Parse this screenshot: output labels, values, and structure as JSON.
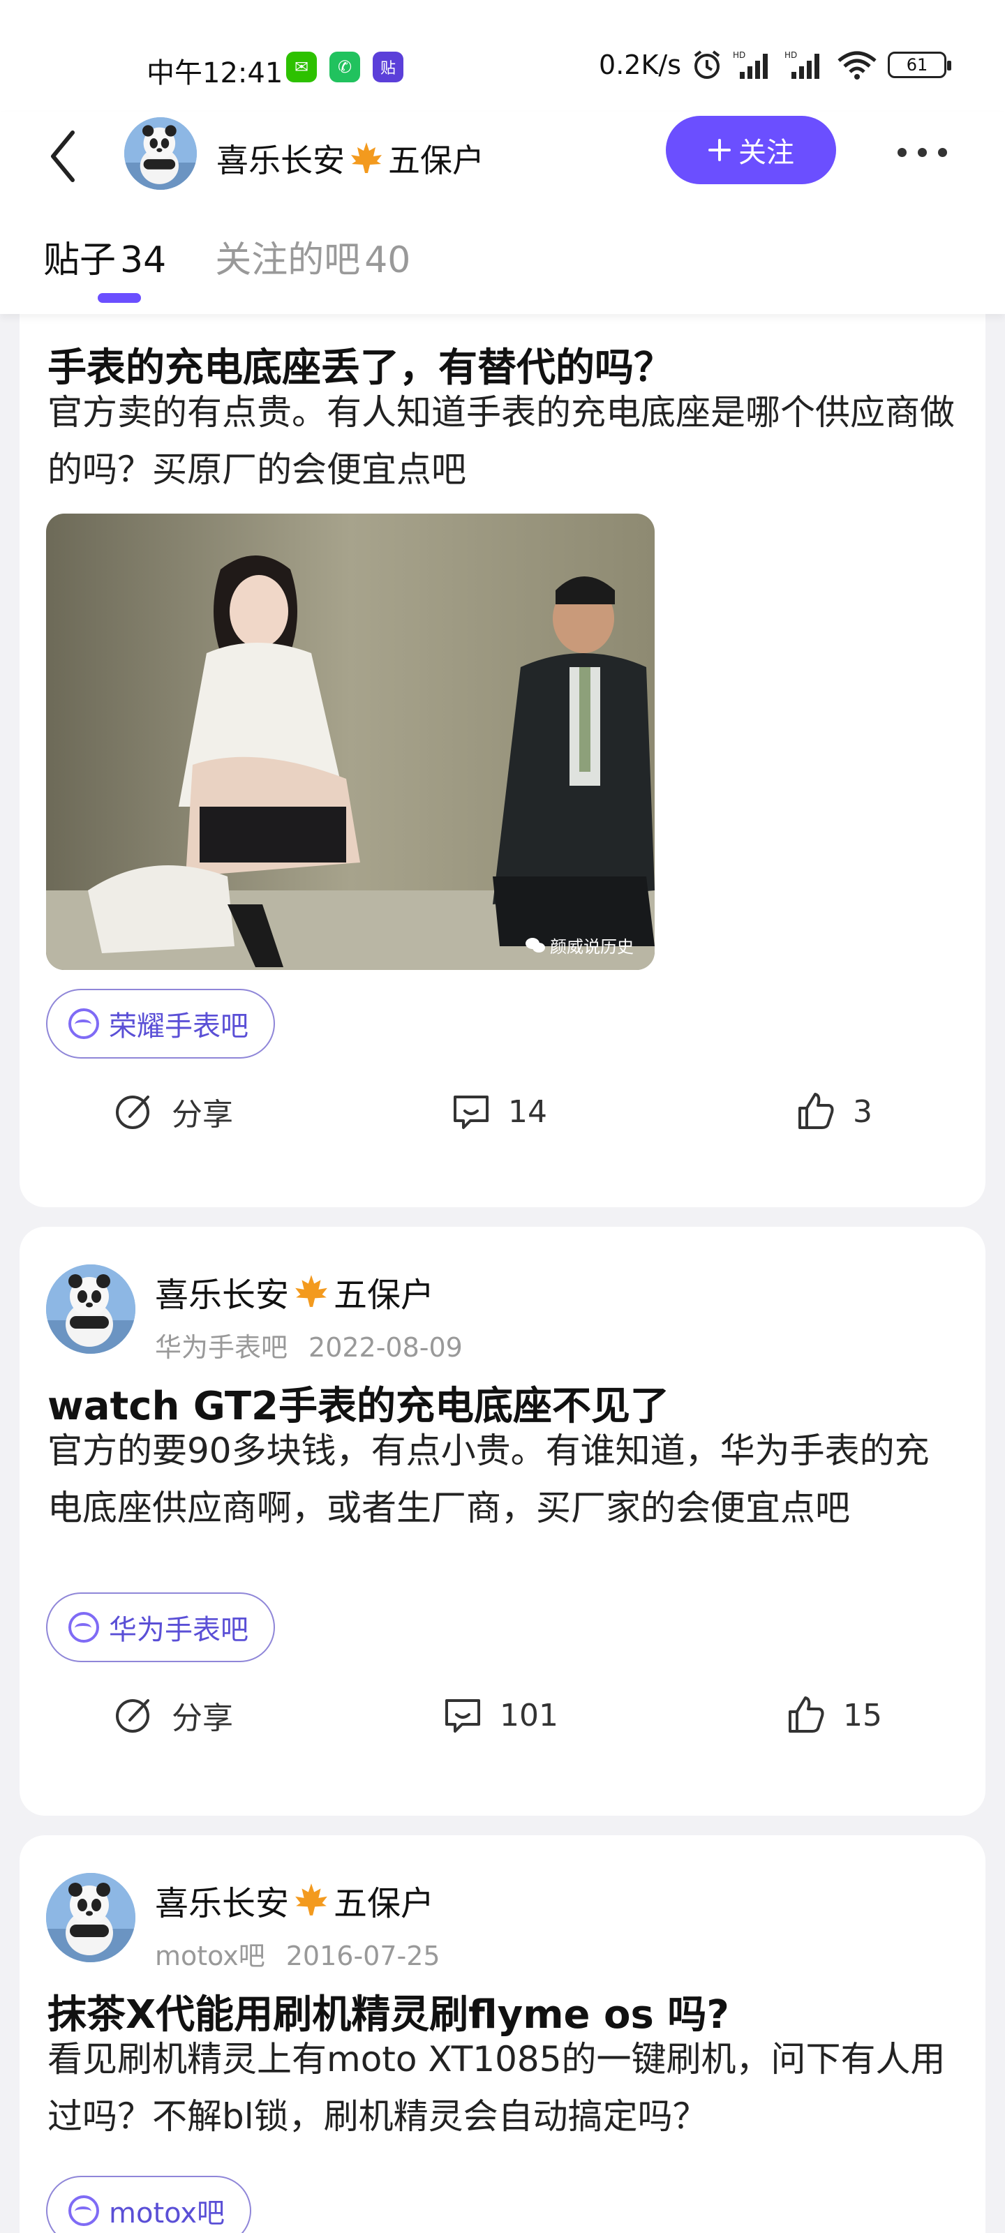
{
  "status_bar": {
    "time": "中午12:41",
    "net_speed": "0.2K/s",
    "battery": "61",
    "apps": [
      {
        "name": "wechat-icon",
        "color": "#2dc100",
        "glyph": "✉"
      },
      {
        "name": "phone-icon",
        "color": "#21c25e",
        "glyph": "✆"
      },
      {
        "name": "tieba-icon",
        "color": "#5b3fd9",
        "glyph": "贴"
      }
    ]
  },
  "header": {
    "user_name": "喜乐长安",
    "user_suffix": "五保户",
    "follow_label": "关注",
    "tabs": [
      {
        "label": "贴子",
        "count": "34"
      },
      {
        "label": "关注的吧",
        "count": "40"
      }
    ]
  },
  "posts": [
    {
      "title": "手表的充电底座丢了，有替代的吗？",
      "body": "官方卖的有点贵。有人知道手表的充电底座是哪个供应商做的吗？买原厂的会便宜点吧",
      "image_watermark": "颜威说历史",
      "forum": "荣耀手表吧",
      "share_label": "分享",
      "comments": "14",
      "likes": "3"
    },
    {
      "author": "喜乐长安",
      "author_suffix": "五保户",
      "forum_meta": "华为手表吧",
      "date": "2022-08-09",
      "title": "watch GT2手表的充电底座不见了",
      "body": "官方的要90多块钱，有点小贵。有谁知道，华为手表的充电底座供应商啊，或者生厂商，买厂家的会便宜点吧",
      "forum": "华为手表吧",
      "share_label": "分享",
      "comments": "101",
      "likes": "15"
    },
    {
      "author": "喜乐长安",
      "author_suffix": "五保户",
      "forum_meta": "motox吧",
      "date": "2016-07-25",
      "title": "抹茶X代能用刷机精灵刷flyme os 吗?",
      "body": "看见刷机精灵上有moto XT1085的一键刷机，问下有人用过吗？不解bl锁，刷机精灵会自动搞定吗？",
      "forum": "motox吧"
    }
  ],
  "colors": {
    "accent": "#6b4fff",
    "tag_text": "#5a4fd6",
    "background": "#f2f2f5",
    "maple": "#f39a1e"
  }
}
